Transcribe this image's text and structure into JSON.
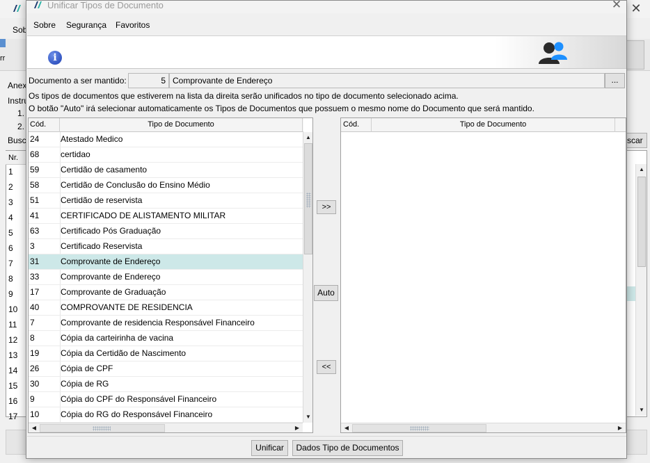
{
  "background_window": {
    "menu_label": "Sobre",
    "left_labels": [
      "Anex",
      "Instru",
      "1.",
      "2.",
      "Busca"
    ],
    "grid_header": "Nr.",
    "row_numbers": [
      "1",
      "2",
      "3",
      "4",
      "5",
      "6",
      "7",
      "8",
      "9",
      "10",
      "11",
      "12",
      "13",
      "14",
      "15",
      "16",
      "17"
    ],
    "buscar_button": "scar"
  },
  "dialog": {
    "title": "Unificar Tipos de Documento",
    "menu": [
      "Sobre",
      "Segurança",
      "Favoritos"
    ],
    "documento_label": "Documento a ser mantido:",
    "documento_code": "5",
    "documento_name": "Comprovante de Endereço",
    "browse_button": "...",
    "instruction_1": "Os tipos de documentos que estiverem na lista da direita serão unificados no tipo de documento selecionado acima.",
    "instruction_2": "O botão \"Auto\" irá selecionar automaticamente os Tipos de Documentos que possuem o mesmo nome do Documento que será mantido.",
    "left_grid": {
      "col_code": "Cód.",
      "col_tipo": "Tipo de Documento",
      "rows": [
        {
          "code": "24",
          "tipo": "Atestado Medico"
        },
        {
          "code": "68",
          "tipo": "certidao"
        },
        {
          "code": "59",
          "tipo": "Certidão de casamento"
        },
        {
          "code": "58",
          "tipo": "Certidão de Conclusão do Ensino Médio"
        },
        {
          "code": "51",
          "tipo": "Certidão de reservista"
        },
        {
          "code": "41",
          "tipo": "CERTIFICADO DE ALISTAMENTO MILITAR"
        },
        {
          "code": "63",
          "tipo": "Certificado Pós Graduação"
        },
        {
          "code": "3",
          "tipo": "Certificado Reservista"
        },
        {
          "code": "31",
          "tipo": "Comprovante de Endereço"
        },
        {
          "code": "33",
          "tipo": "Comprovante de Endereço"
        },
        {
          "code": "17",
          "tipo": "Comprovante de Graduação"
        },
        {
          "code": "40",
          "tipo": "COMPROVANTE DE RESIDENCIA"
        },
        {
          "code": "7",
          "tipo": "Comprovante de residencia Responsável Financeiro"
        },
        {
          "code": "8",
          "tipo": "Cópia da carteirinha de vacina"
        },
        {
          "code": "19",
          "tipo": "Cópia da Certidão de Nascimento"
        },
        {
          "code": "26",
          "tipo": "Cópia de CPF"
        },
        {
          "code": "30",
          "tipo": "Cópia de RG"
        },
        {
          "code": "9",
          "tipo": "Cópia do CPF do Responsável Financeiro"
        },
        {
          "code": "10",
          "tipo": "Cópia do RG do Responsável Financeiro"
        }
      ],
      "selected_code": "31"
    },
    "right_grid": {
      "col_code": "Cód.",
      "col_tipo": "Tipo de Documento",
      "rows": []
    },
    "move_right_button": ">>",
    "auto_button": "Auto",
    "move_left_button": "<<",
    "footer_buttons": {
      "unificar": "Unificar",
      "dados": "Dados Tipo de Documentos"
    }
  },
  "colors": {
    "selected_row": "#cde8e8",
    "window_bg": "#f0f0f0",
    "info_icon": "#1d3fb3",
    "users_icon_accent": "#1e90ff"
  },
  "icons": [
    "app-logo-icon",
    "close-icon",
    "info-icon",
    "users-icon",
    "arrow-up-icon",
    "arrow-down-icon",
    "arrow-left-icon",
    "arrow-right-icon"
  ]
}
